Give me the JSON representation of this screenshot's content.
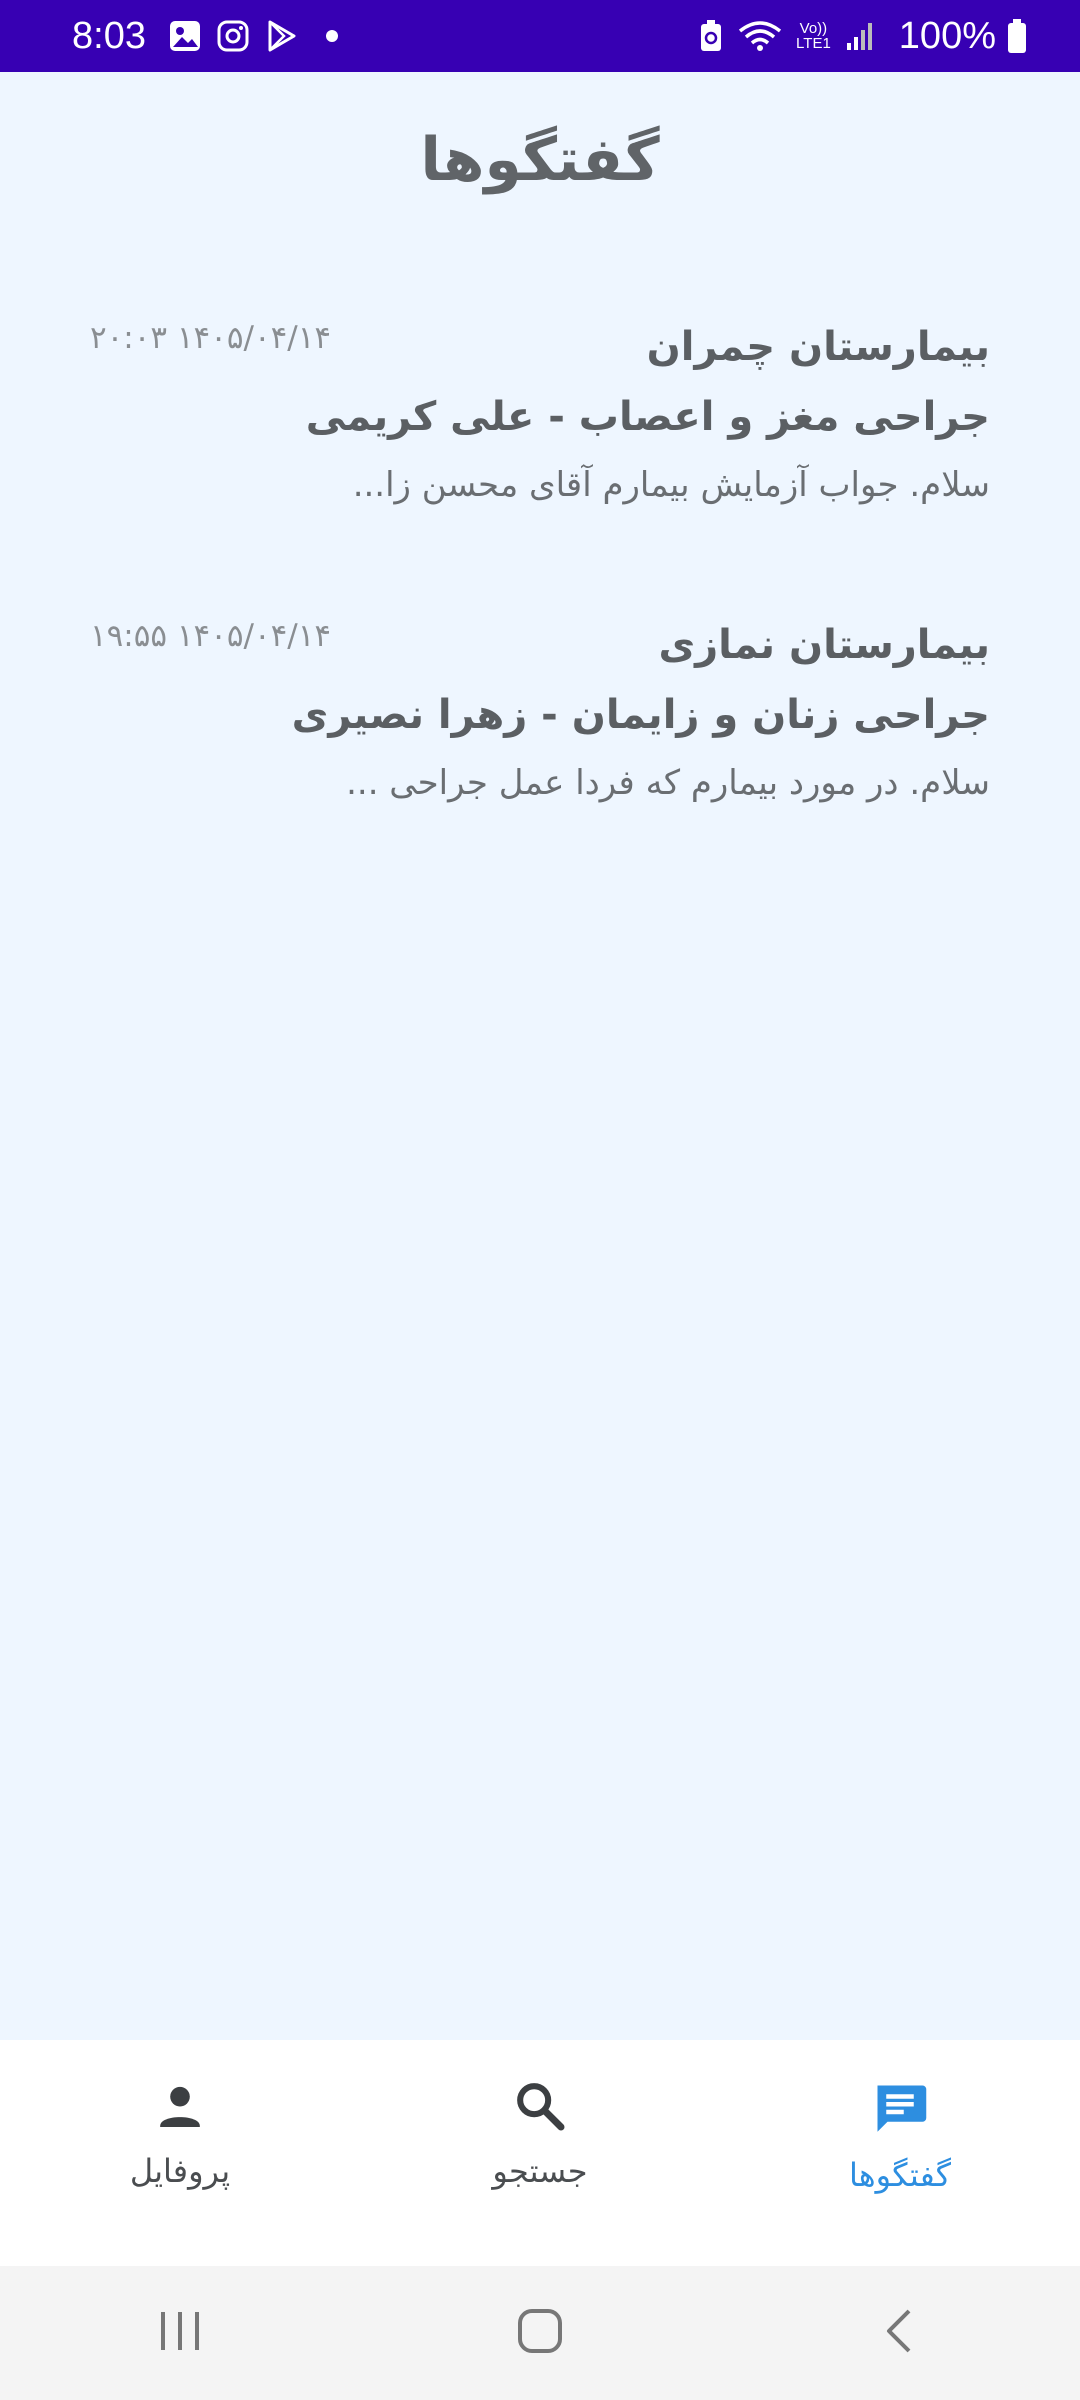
{
  "status_bar": {
    "time": "8:03",
    "lte_label_1": "Vo))",
    "lte_label_2": "LTE1",
    "battery_percent": "100%"
  },
  "header": {
    "title": "گفتگوها"
  },
  "conversations": [
    {
      "hospital": "بیمارستان چمران",
      "doctor": "جراحی مغز و اعصاب - علی کریمی",
      "preview": "سلام. جواب آزمایش بیمارم آقای محسن زا...",
      "time": "۱۴۰۵/۰۴/۱۴ ۲۰:۰۳"
    },
    {
      "hospital": "بیمارستان نمازی",
      "doctor": "جراحی زنان و زایمان - زهرا نصیری",
      "preview": "سلام. در مورد بیمارم که فردا عمل جراحی ...",
      "time": "۱۴۰۵/۰۴/۱۴ ۱۹:۵۵"
    }
  ],
  "bottom_nav": {
    "items": [
      {
        "label": "پروفایل",
        "icon": "person-icon",
        "active": false
      },
      {
        "label": "جستجو",
        "icon": "search-icon",
        "active": false
      },
      {
        "label": "گفتگوها",
        "icon": "chat-icon",
        "active": true
      }
    ],
    "active_color": "#2d8ee0",
    "inactive_color": "#4a4d50"
  },
  "colors": {
    "status_bar": "#3700b3",
    "background": "#eef6ff"
  }
}
